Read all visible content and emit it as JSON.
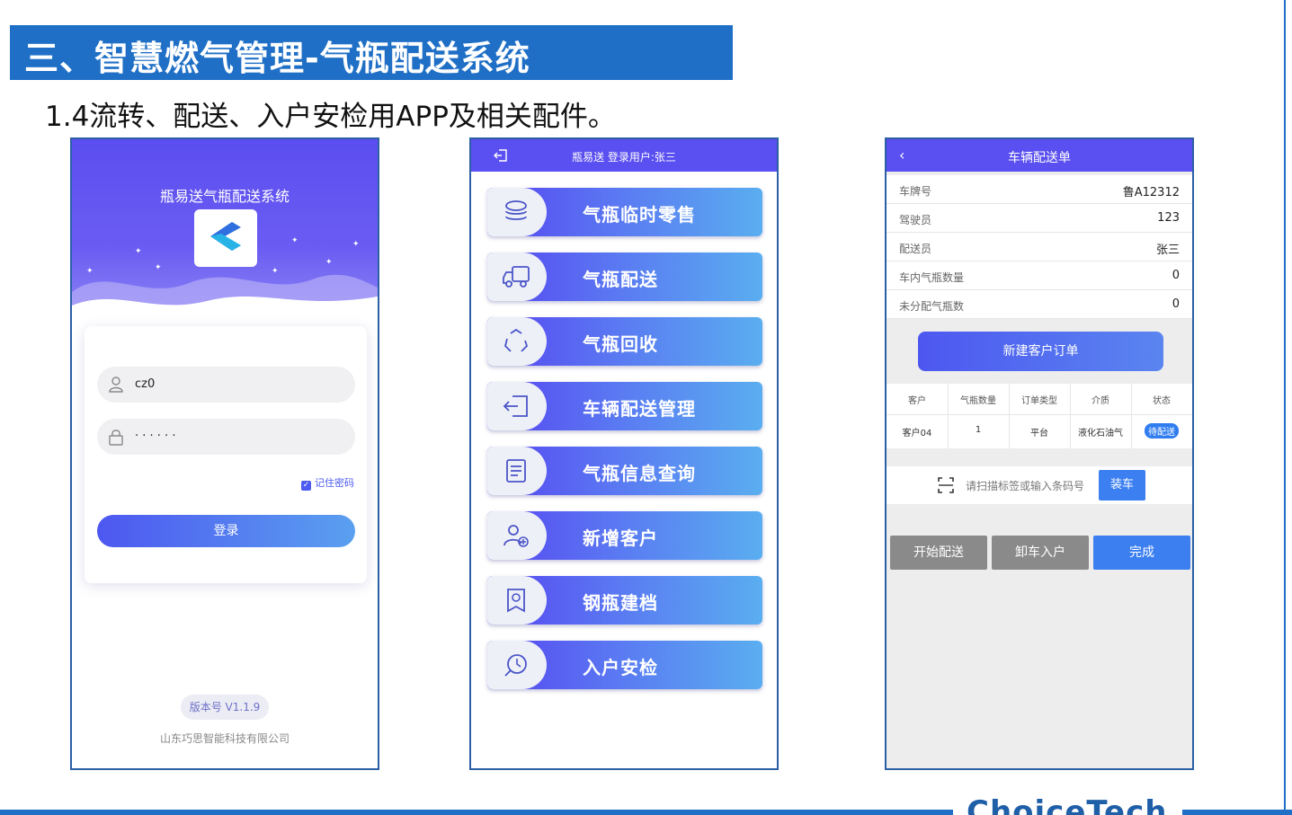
{
  "slide": {
    "banner_title": "三、智慧燃气管理-气瓶配送系统",
    "subtitle": "1.4流转、配送、入户安检用APP及相关配件。",
    "footer_logo": "ChoiceTech"
  },
  "login_screen": {
    "app_title": "瓶易送气瓶配送系统",
    "username_value": "cz0",
    "password_mask": "· · · · · ·",
    "remember_label": "记住密码",
    "login_button": "登录",
    "version": "版本号 V1.1.9",
    "company": "山东巧思智能科技有限公司"
  },
  "menu_screen": {
    "header_title": "瓶易送 登录用户:张三",
    "items": [
      {
        "label": "气瓶临时零售",
        "icon": "coins-icon"
      },
      {
        "label": "气瓶配送",
        "icon": "truck-icon"
      },
      {
        "label": "气瓶回收",
        "icon": "recycle-icon"
      },
      {
        "label": "车辆配送管理",
        "icon": "logout-icon"
      },
      {
        "label": "气瓶信息查询",
        "icon": "document-icon"
      },
      {
        "label": "新增客户",
        "icon": "add-user-icon"
      },
      {
        "label": "钢瓶建档",
        "icon": "archive-icon"
      },
      {
        "label": "入户安检",
        "icon": "inspection-icon"
      }
    ]
  },
  "delivery_screen": {
    "header_title": "车辆配送单",
    "back_glyph": "‹",
    "info": [
      {
        "key": "车牌号",
        "value": "鲁A12312"
      },
      {
        "key": "驾驶员",
        "value": "123"
      },
      {
        "key": "配送员",
        "value": "张三"
      },
      {
        "key": "车内气瓶数量",
        "value": "0"
      },
      {
        "key": "未分配气瓶数",
        "value": "0"
      }
    ],
    "new_order_button": "新建客户订单",
    "table": {
      "headers": [
        "客户",
        "气瓶数量",
        "订单类型",
        "介质",
        "状态"
      ],
      "row": [
        "客户04",
        "1",
        "平台",
        "液化石油气",
        "待配送"
      ]
    },
    "scan_placeholder": "请扫描标签或输入条码号",
    "load_button": "装车",
    "actions": [
      "开始配送",
      "卸车入户",
      "完成"
    ]
  },
  "colors": {
    "banner": "#1f6fc6",
    "primary_purple": "#5a4ff0",
    "action_gray": "#8a8a8a",
    "action_blue": "#3b7ff0"
  }
}
